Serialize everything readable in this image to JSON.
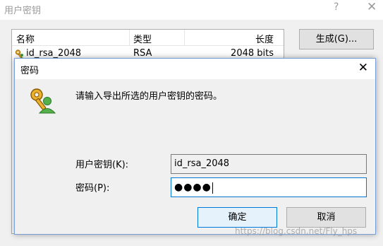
{
  "outer": {
    "title": "用户密钥",
    "help": "?",
    "close": "✕",
    "columns": [
      "名称",
      "类型",
      "长度"
    ],
    "rows": [
      {
        "name": "id_rsa_2048",
        "type": "RSA",
        "length": "2048 bits"
      }
    ],
    "buttons": {
      "generate": "生成(G)..."
    }
  },
  "dialog": {
    "title": "密码",
    "close": "✕",
    "message": "请输入导出所选的用户密钥的密码。",
    "user_key_label": "用户密钥(K):",
    "user_key_value": "id_rsa_2048",
    "password_label": "密码(P):",
    "password_dots": "●●●●",
    "ok": "确定",
    "cancel": "取消"
  },
  "watermark": "https://blog.csdn.net/Fly_hps",
  "icons": {
    "key_row": "user-key-icon",
    "dialog": "user-key-icon"
  },
  "colors": {
    "focus_border": "#0078d7",
    "dialog_border": "#7a9ed6",
    "face": "#f0f0f0"
  }
}
